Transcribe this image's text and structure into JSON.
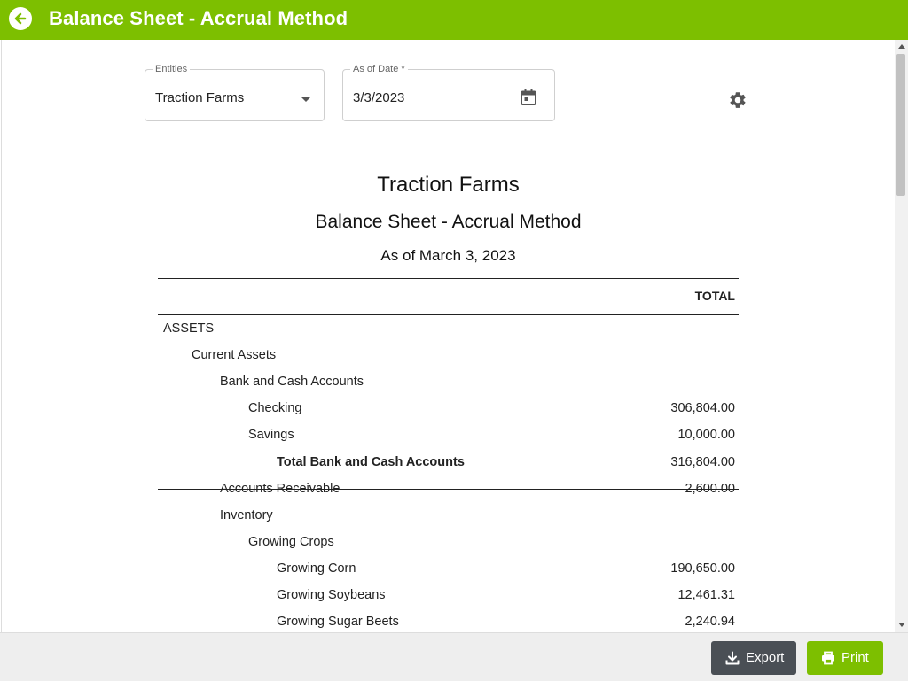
{
  "header": {
    "title": "Balance Sheet - Accrual Method"
  },
  "filters": {
    "entities": {
      "label": "Entities",
      "value": "Traction Farms"
    },
    "as_of_date": {
      "label": "As of Date *",
      "value": "3/3/2023"
    }
  },
  "report": {
    "company": "Traction Farms",
    "name": "Balance Sheet - Accrual Method",
    "as_of": "As of March 3, 2023",
    "column_header": "TOTAL",
    "rows": [
      {
        "label": "ASSETS",
        "amount": ""
      },
      {
        "label": "Current Assets",
        "amount": ""
      },
      {
        "label": "Bank and Cash Accounts",
        "amount": ""
      },
      {
        "label": "Checking",
        "amount": "306,804.00"
      },
      {
        "label": "Savings",
        "amount": "10,000.00"
      },
      {
        "label": "Total Bank and Cash Accounts",
        "amount": "316,804.00"
      },
      {
        "label": "Accounts Receivable",
        "amount": "2,600.00"
      },
      {
        "label": "Inventory",
        "amount": ""
      },
      {
        "label": "Growing Crops",
        "amount": ""
      },
      {
        "label": "Growing Corn",
        "amount": "190,650.00"
      },
      {
        "label": "Growing Soybeans",
        "amount": "12,461.31"
      },
      {
        "label": "Growing Sugar Beets",
        "amount": "2,240.94"
      }
    ]
  },
  "footer": {
    "export_label": "Export",
    "print_label": "Print"
  }
}
